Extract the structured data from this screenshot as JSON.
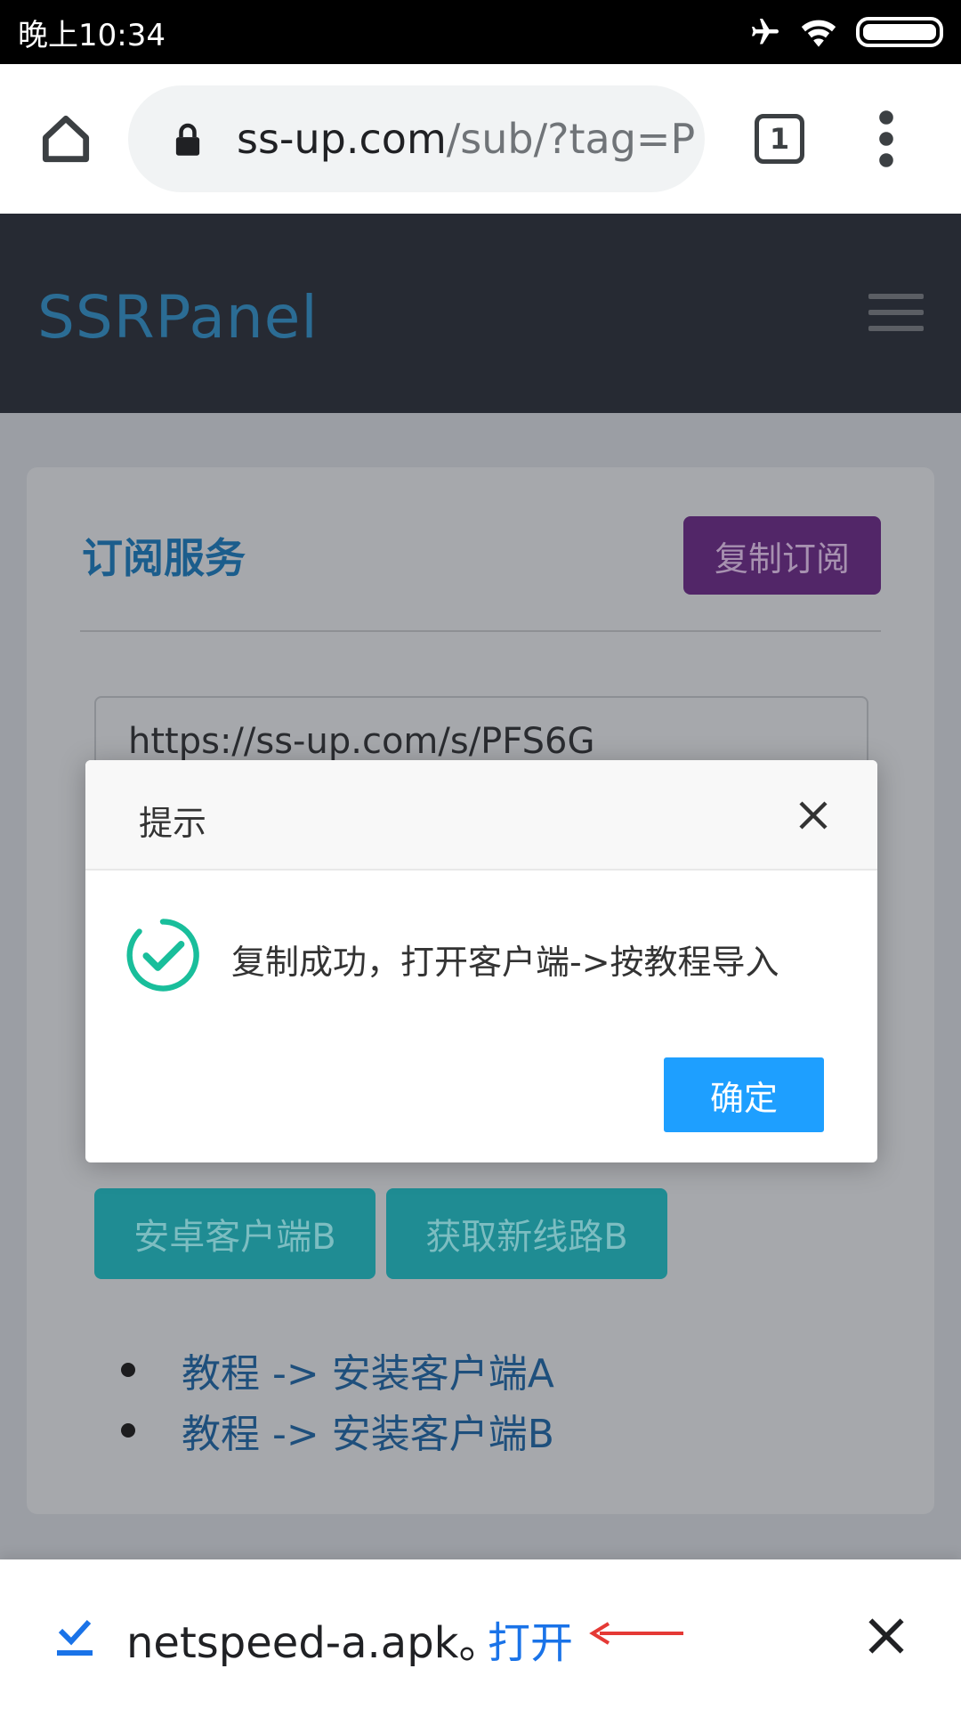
{
  "status_bar": {
    "time": "晚上10:34"
  },
  "browser": {
    "url_host": "ss-up.com",
    "url_path": "/sub/?tag=P",
    "tab_count": "1"
  },
  "site": {
    "brand": "SSRPanel"
  },
  "card": {
    "title": "订阅服务",
    "copy_button": "复制订阅",
    "subscription_url": "https://ss-up.com/s/PFS6G",
    "buttons": [
      "安卓客户端B",
      "获取新线路B"
    ],
    "guides": [
      "教程 -> 安装客户端A",
      "教程 -> 安装客户端B"
    ]
  },
  "dialog": {
    "title": "提示",
    "message": "复制成功，打开客户端->按教程导入",
    "ok": "确定"
  },
  "download": {
    "filename": "netspeed-a.apk。",
    "open": "打开"
  },
  "colors": {
    "header_bg": "#262a33",
    "brand": "#2b6c94",
    "copy_button": "#522668",
    "teal_button": "#1f8c93",
    "ok_button": "#1e9fff",
    "success": "#19be9b",
    "link_blue": "#1a73e8",
    "annotation_arrow": "#e53935"
  }
}
